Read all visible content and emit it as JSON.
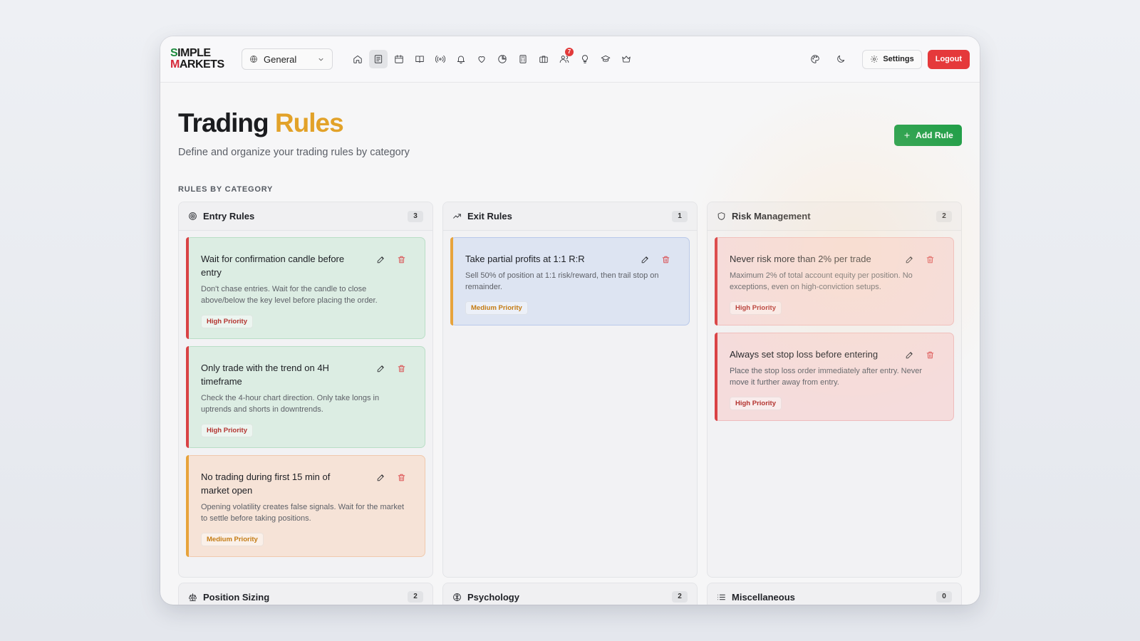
{
  "header": {
    "logo_line1": "SIMPLE",
    "logo_line2": "MARKETS",
    "workspace": "General",
    "nav_icons": [
      "home-icon",
      "journal-icon",
      "calendar-icon",
      "book-icon",
      "signal-icon",
      "bell-icon",
      "heart-icon",
      "pie-chart-icon",
      "calculator-icon",
      "briefcase-icon",
      "community-icon",
      "lightbulb-icon",
      "graduation-cap-icon",
      "crown-icon"
    ],
    "notification_count": "7",
    "settings_label": "Settings",
    "logout_label": "Logout"
  },
  "page": {
    "title_main": "Trading",
    "title_highlight": "Rules",
    "subtitle": "Define and organize your trading rules by category",
    "add_rule_label": "Add Rule",
    "section_label": "RULES BY CATEGORY"
  },
  "categories": [
    {
      "name": "Entry Rules",
      "count": "3",
      "icon": "target-icon",
      "rules": [
        {
          "title": "Wait for confirmation candle before entry",
          "desc": "Don't chase entries. Wait for the candle to close above/below the key level before placing the order.",
          "priority": "High Priority"
        },
        {
          "title": "Only trade with the trend on 4H timeframe",
          "desc": "Check the 4-hour chart direction. Only take longs in uptrends and shorts in downtrends.",
          "priority": "High Priority"
        },
        {
          "title": "No trading during first 15 min of market open",
          "desc": "Opening volatility creates false signals. Wait for the market to settle before taking positions.",
          "priority": "Medium Priority"
        }
      ]
    },
    {
      "name": "Exit Rules",
      "count": "1",
      "icon": "trending-up-icon",
      "rules": [
        {
          "title": "Take partial profits at 1:1 R:R",
          "desc": "Sell 50% of position at 1:1 risk/reward, then trail stop on remainder.",
          "priority": "Medium Priority"
        }
      ]
    },
    {
      "name": "Risk Management",
      "count": "2",
      "icon": "shield-icon",
      "rules": [
        {
          "title": "Never risk more than 2% per trade",
          "desc": "Maximum 2% of total account equity per position. No exceptions, even on high-conviction setups.",
          "priority": "High Priority"
        },
        {
          "title": "Always set stop loss before entering",
          "desc": "Place the stop loss order immediately after entry. Never move it further away from entry.",
          "priority": "High Priority"
        }
      ]
    },
    {
      "name": "Position Sizing",
      "count": "2",
      "icon": "scale-icon"
    },
    {
      "name": "Psychology",
      "count": "2",
      "icon": "brain-icon"
    },
    {
      "name": "Miscellaneous",
      "count": "0",
      "icon": "list-icon"
    }
  ],
  "colors": {
    "accent_yellow": "#e2a229",
    "add_button": "#1f9e47",
    "logout_button": "#e5393b",
    "high_priority": "#d94245",
    "medium_priority": "#e7a33b"
  }
}
